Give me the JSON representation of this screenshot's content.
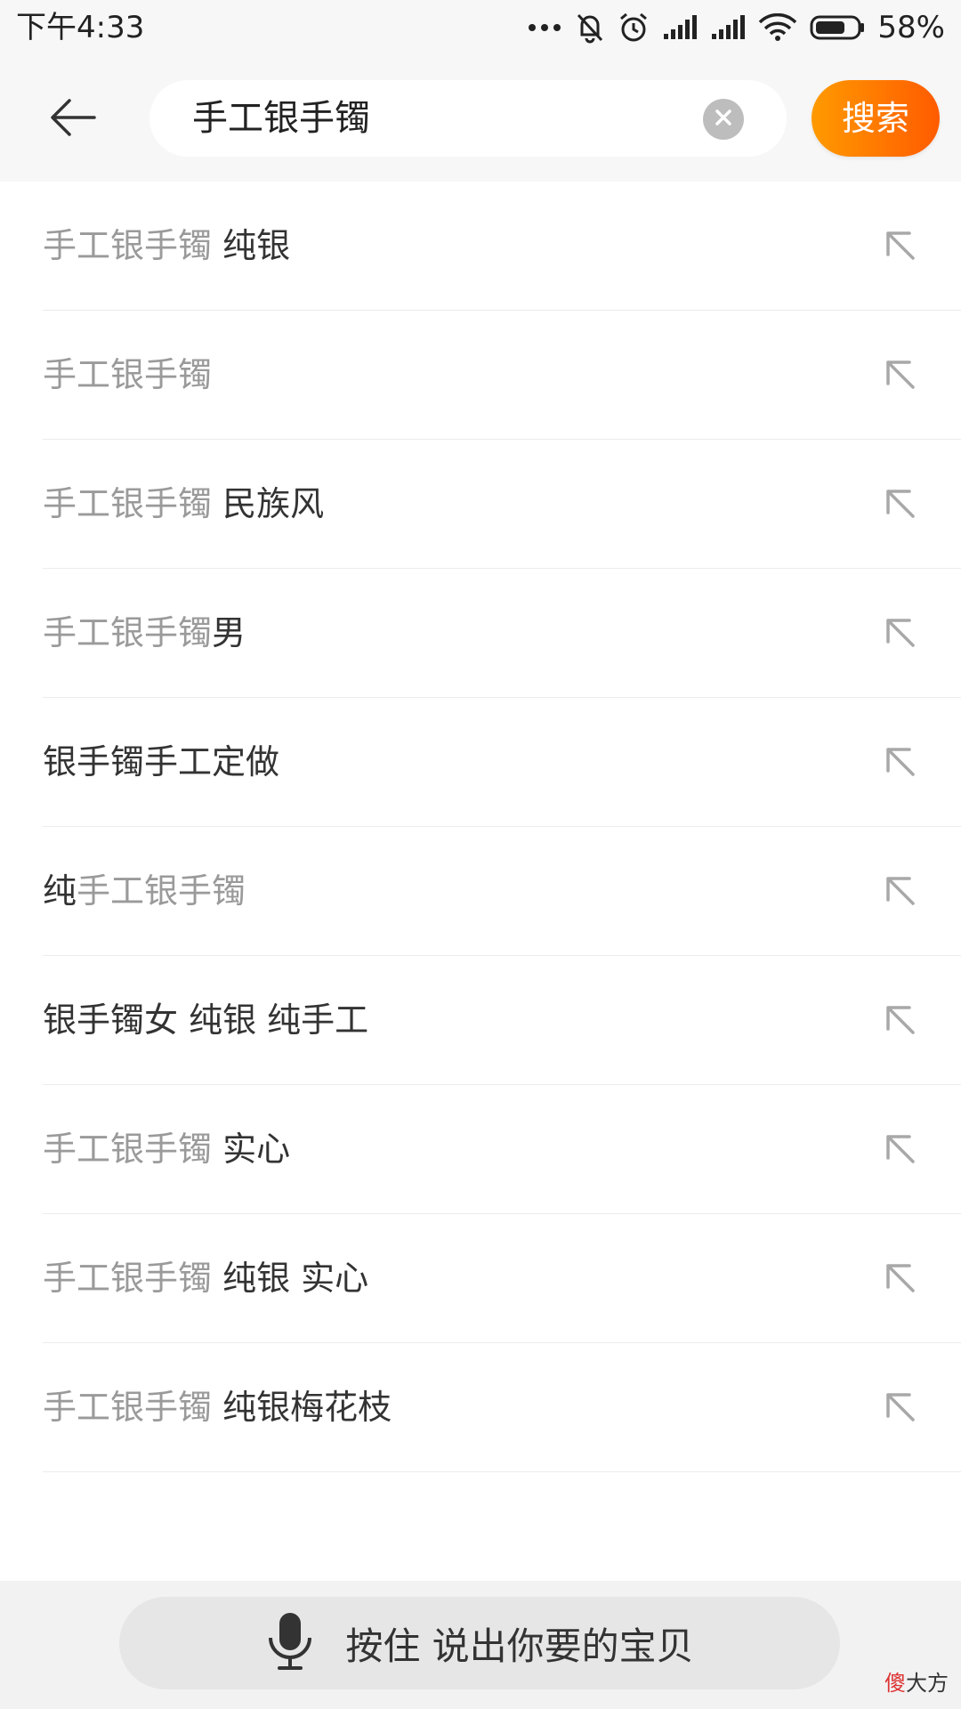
{
  "status_bar": {
    "time": "下午4:33",
    "battery": "58%",
    "icons": [
      "more-dots-icon",
      "notification-muted-icon",
      "alarm-icon",
      "signal-icon",
      "signal-icon",
      "wifi-icon",
      "battery-icon"
    ]
  },
  "header": {
    "back_icon": "back-arrow-icon",
    "search_value": "手工银手镯",
    "clear_icon": "clear-icon",
    "search_label": "搜索"
  },
  "suggestions": [
    {
      "match": "手工银手镯",
      "rest": " 纯银"
    },
    {
      "match": "手工银手镯",
      "rest": ""
    },
    {
      "match": "手工银手镯",
      "rest": " 民族风"
    },
    {
      "match": "手工银手镯",
      "rest": "男"
    },
    {
      "prefix": "银手镯手工定做"
    },
    {
      "prefix": "纯",
      "match": "手工银手镯"
    },
    {
      "prefix": "银手镯女 纯银 纯手工"
    },
    {
      "match": "手工银手镯",
      "rest": " 实心"
    },
    {
      "match": "手工银手镯",
      "rest": " 纯银 实心"
    },
    {
      "match": "手工银手镯",
      "rest": " 纯银梅花枝"
    }
  ],
  "bottom": {
    "voice_icon": "microphone-icon",
    "voice_label": "按住 说出你要的宝贝"
  },
  "watermark": {
    "red": "傻",
    "rest": "大方"
  },
  "colors": {
    "accent_start": "#ff9a00",
    "accent_end": "#ff5b00",
    "match_text": "#9a9a9a",
    "normal_text": "#333333"
  }
}
